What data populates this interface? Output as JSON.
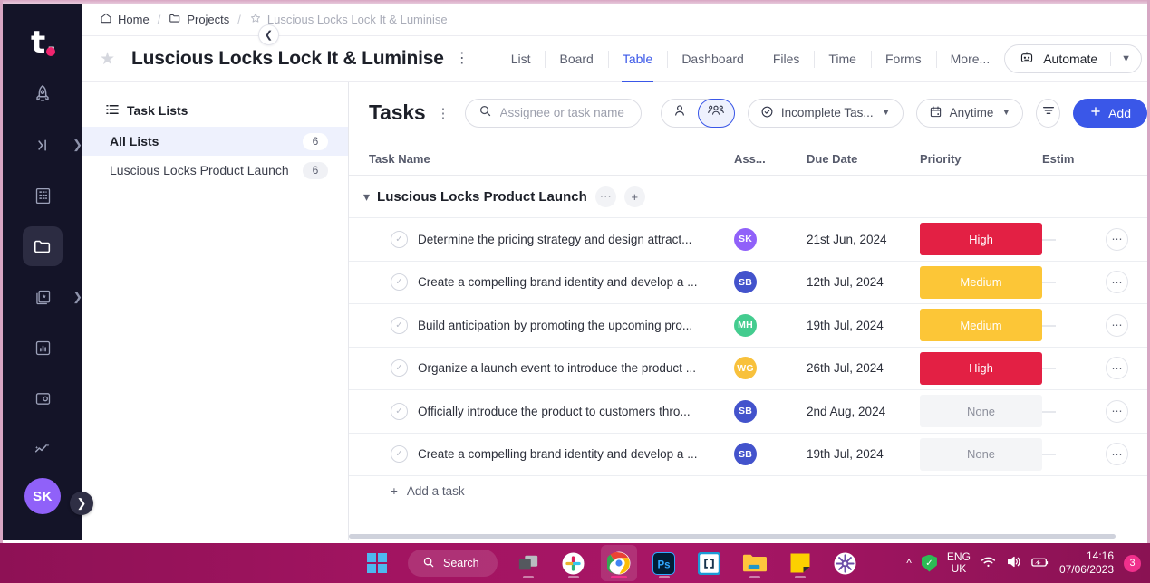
{
  "rail": {
    "logo": "t.",
    "items": [
      {
        "name": "rocket",
        "icon": "rocket-icon"
      },
      {
        "name": "collapse",
        "icon": "collapse-icon"
      },
      {
        "name": "grid",
        "icon": "grid-icon"
      },
      {
        "name": "projects",
        "icon": "folder-icon"
      },
      {
        "name": "templates",
        "icon": "template-icon"
      },
      {
        "name": "reports",
        "icon": "chart-icon"
      },
      {
        "name": "finance",
        "icon": "wallet-icon"
      },
      {
        "name": "insights",
        "icon": "trend-icon"
      }
    ],
    "avatar": "SK"
  },
  "breadcrumb": {
    "home": "Home",
    "projects": "Projects",
    "current": "Luscious Locks Lock It & Luminise",
    "separator": "/"
  },
  "project": {
    "title": "Luscious Locks Lock It & Luminise",
    "tabs": [
      {
        "label": "List",
        "active": false
      },
      {
        "label": "Board",
        "active": false
      },
      {
        "label": "Table",
        "active": true
      },
      {
        "label": "Dashboard",
        "active": false
      },
      {
        "label": "Files",
        "active": false
      },
      {
        "label": "Time",
        "active": false
      },
      {
        "label": "Forms",
        "active": false
      },
      {
        "label": "More...",
        "active": false
      }
    ],
    "automate_label": "Automate"
  },
  "sidebar": {
    "heading": "Task Lists",
    "items": [
      {
        "label": "All Lists",
        "count": "6",
        "selected": true
      },
      {
        "label": "Luscious Locks Product Launch",
        "count": "6",
        "selected": false
      }
    ]
  },
  "toolbar": {
    "title": "Tasks",
    "search_placeholder": "Assignee or task name",
    "search_value": "",
    "filter_status": "Incomplete Tas...",
    "filter_date": "Anytime",
    "add_label": "Add"
  },
  "table": {
    "columns": [
      "Task Name",
      "Ass...",
      "Due Date",
      "Priority",
      "Estim"
    ],
    "group": {
      "name": "Luscious Locks Product Launch"
    },
    "add_task_label": "Add a task",
    "rows": [
      {
        "task": "Determine the pricing strategy and design attract...",
        "assignee": "SK",
        "avatar_color": "#9061f9",
        "due": "21st Jun, 2024",
        "priority": "High",
        "priority_color": "#e32044",
        "estimate": "—"
      },
      {
        "task": "Create a compelling brand identity and develop a ...",
        "assignee": "SB",
        "avatar_color": "#4353cc",
        "due": "12th Jul, 2024",
        "priority": "Medium",
        "priority_color": "#fcc637",
        "estimate": "—"
      },
      {
        "task": "Build anticipation by promoting the upcoming pro...",
        "assignee": "MH",
        "avatar_color": "#44cc8f",
        "due": "19th Jul, 2024",
        "priority": "Medium",
        "priority_color": "#fcc637",
        "estimate": "—"
      },
      {
        "task": "Organize a launch event to introduce the product ...",
        "assignee": "WG",
        "avatar_color": "#f8c13c",
        "due": "26th Jul, 2024",
        "priority": "High",
        "priority_color": "#e32044",
        "estimate": "—"
      },
      {
        "task": "Officially introduce the product to customers thro...",
        "assignee": "SB",
        "avatar_color": "#4353cc",
        "due": "2nd Aug, 2024",
        "priority": "None",
        "priority_color": "#f4f5f7",
        "estimate": "—"
      },
      {
        "task": "Create a compelling brand identity and develop a ...",
        "assignee": "SB",
        "avatar_color": "#4353cc",
        "due": "19th Jul, 2024",
        "priority": "None",
        "priority_color": "#f4f5f7",
        "estimate": "—"
      }
    ]
  },
  "taskbar": {
    "search_label": "Search",
    "apps": [
      {
        "name": "start-button"
      },
      {
        "name": "task-view"
      },
      {
        "name": "slack"
      },
      {
        "name": "chrome"
      },
      {
        "name": "photoshop"
      },
      {
        "name": "brackets"
      },
      {
        "name": "file-explorer"
      },
      {
        "name": "sticky-notes"
      },
      {
        "name": "flower-app"
      }
    ],
    "language": "ENG",
    "region": "UK",
    "time": "14:16",
    "date": "07/06/2023",
    "notification_count": "3"
  },
  "colors": {
    "accent": "#3a57e8",
    "high": "#e32044",
    "medium": "#fcc637",
    "none": "#f4f5f7",
    "rail": "#141428",
    "taskbar": "#a21461"
  }
}
